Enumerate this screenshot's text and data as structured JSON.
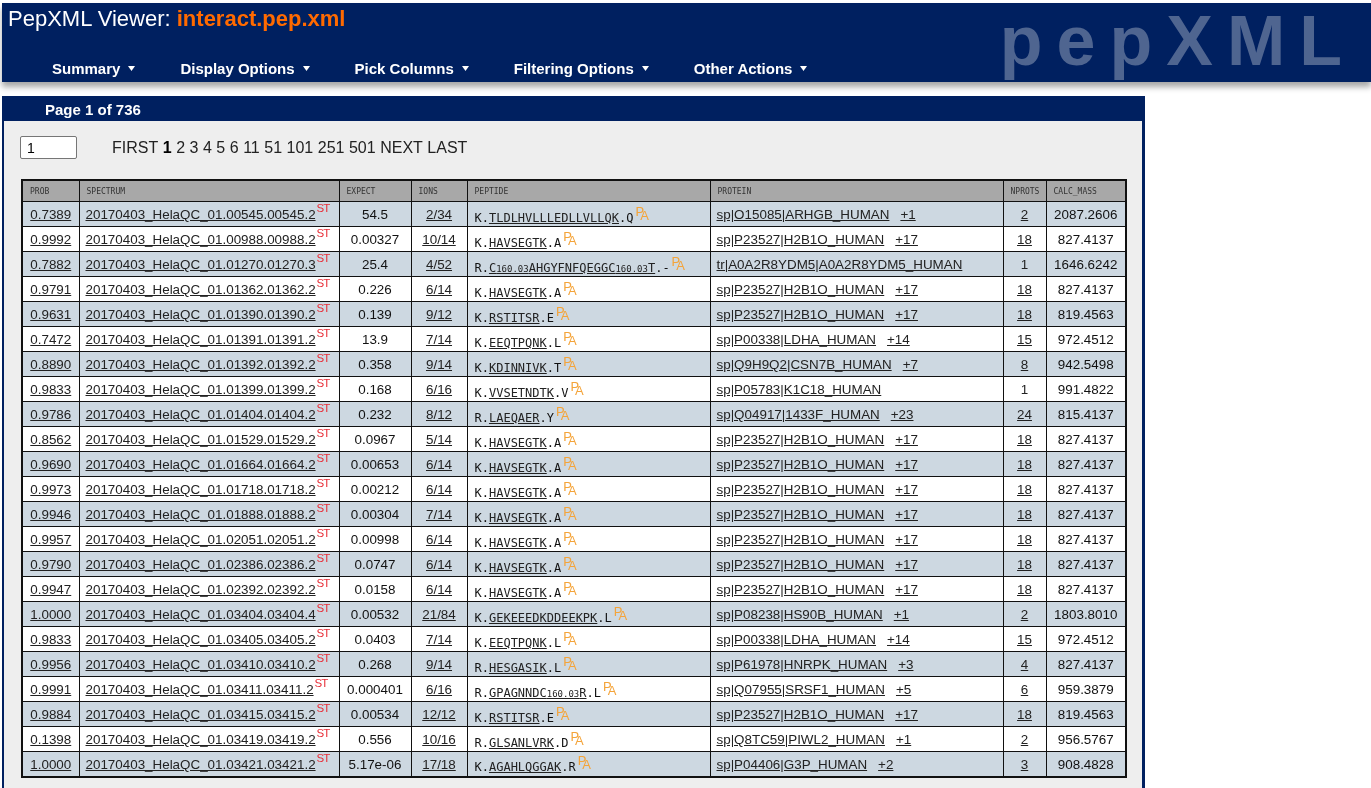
{
  "header": {
    "title": "PepXML Viewer: **interact.pep.xml**",
    "logo": "pepXML"
  },
  "menu": [
    {
      "label": "Summary"
    },
    {
      "label": "Display Options"
    },
    {
      "label": "Pick Columns"
    },
    {
      "label": "Filtering Options"
    },
    {
      "label": "Other Actions"
    }
  ],
  "page_bar": {
    "title": "Page 1 of 736"
  },
  "pager": {
    "value": "1",
    "links": [
      {
        "label": "FIRST",
        "selected": false
      },
      {
        "label": "1",
        "selected": true
      },
      {
        "label": "2",
        "selected": false
      },
      {
        "label": "3",
        "selected": false
      },
      {
        "label": "4",
        "selected": false
      },
      {
        "label": "5",
        "selected": false
      },
      {
        "label": "6",
        "selected": false
      },
      {
        "label": "11",
        "selected": false
      },
      {
        "label": "51",
        "selected": false
      },
      {
        "label": "101",
        "selected": false
      },
      {
        "label": "251",
        "selected": false
      },
      {
        "label": "501",
        "selected": false
      },
      {
        "label": "NEXT",
        "selected": false
      },
      {
        "label": "LAST",
        "selected": false
      }
    ]
  },
  "table": {
    "columns": [
      "PROB",
      "SPECTRUM",
      "EXPECT",
      "IONS",
      "PEPTIDE",
      "PROTEIN",
      "NPROTS",
      "CALC_MASS"
    ],
    "rows": [
      {
        "prob": "0.7389",
        "spectrum": "20170403_HelaQC_01.00545.00545.2",
        "spectrum_tag": "ST",
        "expect": "54.5",
        "ions": "2/34",
        "peptide": {
          "prev": "K.",
          "sequence": "TLDLHVLLLEDLLVLLQK",
          "next": ".Q",
          "tag": "PA"
        },
        "protein": "sp|O15085|ARHGB_HUMAN",
        "more": "+1",
        "nprots": "2",
        "nprots_linked": true,
        "calc_mass": "2087.2606"
      },
      {
        "prob": "0.9992",
        "spectrum": "20170403_HelaQC_01.00988.00988.2",
        "spectrum_tag": "ST",
        "expect": "0.00327",
        "ions": "10/14",
        "peptide": {
          "prev": "K.",
          "sequence": "HAVSEGTK",
          "next": ".A",
          "tag": "PA"
        },
        "protein": "sp|P23527|H2B1O_HUMAN",
        "more": "+17",
        "nprots": "18",
        "nprots_linked": true,
        "calc_mass": "827.4137"
      },
      {
        "prob": "0.7882",
        "spectrum": "20170403_HelaQC_01.01270.01270.3",
        "spectrum_tag": "ST",
        "expect": "25.4",
        "ions": "4/52",
        "peptide": {
          "prev": "R.",
          "sequence": "C$_{160.03}$AHGYFNFQEGGC$_{160.03}$T",
          "next": ".-",
          "tag": "PA"
        },
        "protein": "tr|A0A2R8YDM5|A0A2R8YDM5_HUMAN",
        "nprots": "1",
        "nprots_linked": false,
        "calc_mass": "1646.6242"
      },
      {
        "prob": "0.9791",
        "spectrum": "20170403_HelaQC_01.01362.01362.2",
        "spectrum_tag": "ST",
        "expect": "0.226",
        "ions": "6/14",
        "peptide": {
          "prev": "K.",
          "sequence": "HAVSEGTK",
          "next": ".A",
          "tag": "PA"
        },
        "protein": "sp|P23527|H2B1O_HUMAN",
        "more": "+17",
        "nprots": "18",
        "nprots_linked": true,
        "calc_mass": "827.4137"
      },
      {
        "prob": "0.9631",
        "spectrum": "20170403_HelaQC_01.01390.01390.2",
        "spectrum_tag": "ST",
        "expect": "0.139",
        "ions": "9/12",
        "peptide": {
          "prev": "K.",
          "sequence": "RSTITSR",
          "next": ".E",
          "tag": "PA"
        },
        "protein": "sp|P23527|H2B1O_HUMAN",
        "more": "+17",
        "nprots": "18",
        "nprots_linked": true,
        "calc_mass": "819.4563"
      },
      {
        "prob": "0.7472",
        "spectrum": "20170403_HelaQC_01.01391.01391.2",
        "spectrum_tag": "ST",
        "expect": "13.9",
        "ions": "7/14",
        "peptide": {
          "prev": "K.",
          "sequence": "EEQTPQNK",
          "next": ".L",
          "tag": "PA"
        },
        "protein": "sp|P00338|LDHA_HUMAN",
        "more": "+14",
        "nprots": "15",
        "nprots_linked": true,
        "calc_mass": "972.4512"
      },
      {
        "prob": "0.8890",
        "spectrum": "20170403_HelaQC_01.01392.01392.2",
        "spectrum_tag": "ST",
        "expect": "0.358",
        "ions": "9/14",
        "peptide": {
          "prev": "K.",
          "sequence": "KDINNIVK",
          "next": ".T",
          "tag": "PA"
        },
        "protein": "sp|Q9H9Q2|CSN7B_HUMAN",
        "more": "+7",
        "nprots": "8",
        "nprots_linked": true,
        "calc_mass": "942.5498"
      },
      {
        "prob": "0.9833",
        "spectrum": "20170403_HelaQC_01.01399.01399.2",
        "spectrum_tag": "ST",
        "expect": "0.168",
        "ions": "6/16",
        "peptide": {
          "prev": "K.",
          "sequence": "VVSETNDTK",
          "next": ".V",
          "tag": "PA"
        },
        "protein": "sp|P05783|K1C18_HUMAN",
        "nprots": "1",
        "nprots_linked": false,
        "calc_mass": "991.4822"
      },
      {
        "prob": "0.9786",
        "spectrum": "20170403_HelaQC_01.01404.01404.2",
        "spectrum_tag": "ST",
        "expect": "0.232",
        "ions": "8/12",
        "peptide": {
          "prev": "R.",
          "sequence": "LAEQAER",
          "next": ".Y",
          "tag": "PA"
        },
        "protein": "sp|Q04917|1433F_HUMAN",
        "more": "+23",
        "nprots": "24",
        "nprots_linked": true,
        "calc_mass": "815.4137"
      },
      {
        "prob": "0.8562",
        "spectrum": "20170403_HelaQC_01.01529.01529.2",
        "spectrum_tag": "ST",
        "expect": "0.0967",
        "ions": "5/14",
        "peptide": {
          "prev": "K.",
          "sequence": "HAVSEGTK",
          "next": ".A",
          "tag": "PA"
        },
        "protein": "sp|P23527|H2B1O_HUMAN",
        "more": "+17",
        "nprots": "18",
        "nprots_linked": true,
        "calc_mass": "827.4137"
      },
      {
        "prob": "0.9690",
        "spectrum": "20170403_HelaQC_01.01664.01664.2",
        "spectrum_tag": "ST",
        "expect": "0.00653",
        "ions": "6/14",
        "peptide": {
          "prev": "K.",
          "sequence": "HAVSEGTK",
          "next": ".A",
          "tag": "PA"
        },
        "protein": "sp|P23527|H2B1O_HUMAN",
        "more": "+17",
        "nprots": "18",
        "nprots_linked": true,
        "calc_mass": "827.4137"
      },
      {
        "prob": "0.9973",
        "spectrum": "20170403_HelaQC_01.01718.01718.2",
        "spectrum_tag": "ST",
        "expect": "0.00212",
        "ions": "6/14",
        "peptide": {
          "prev": "K.",
          "sequence": "HAVSEGTK",
          "next": ".A",
          "tag": "PA"
        },
        "protein": "sp|P23527|H2B1O_HUMAN",
        "more": "+17",
        "nprots": "18",
        "nprots_linked": true,
        "calc_mass": "827.4137"
      },
      {
        "prob": "0.9946",
        "spectrum": "20170403_HelaQC_01.01888.01888.2",
        "spectrum_tag": "ST",
        "expect": "0.00304",
        "ions": "7/14",
        "peptide": {
          "prev": "K.",
          "sequence": "HAVSEGTK",
          "next": ".A",
          "tag": "PA"
        },
        "protein": "sp|P23527|H2B1O_HUMAN",
        "more": "+17",
        "nprots": "18",
        "nprots_linked": true,
        "calc_mass": "827.4137"
      },
      {
        "prob": "0.9957",
        "spectrum": "20170403_HelaQC_01.02051.02051.2",
        "spectrum_tag": "ST",
        "expect": "0.00998",
        "ions": "6/14",
        "peptide": {
          "prev": "K.",
          "sequence": "HAVSEGTK",
          "next": ".A",
          "tag": "PA"
        },
        "protein": "sp|P23527|H2B1O_HUMAN",
        "more": "+17",
        "nprots": "18",
        "nprots_linked": true,
        "calc_mass": "827.4137"
      },
      {
        "prob": "0.9790",
        "spectrum": "20170403_HelaQC_01.02386.02386.2",
        "spectrum_tag": "ST",
        "expect": "0.0747",
        "ions": "6/14",
        "peptide": {
          "prev": "K.",
          "sequence": "HAVSEGTK",
          "next": ".A",
          "tag": "PA"
        },
        "protein": "sp|P23527|H2B1O_HUMAN",
        "more": "+17",
        "nprots": "18",
        "nprots_linked": true,
        "calc_mass": "827.4137"
      },
      {
        "prob": "0.9947",
        "spectrum": "20170403_HelaQC_01.02392.02392.2",
        "spectrum_tag": "ST",
        "expect": "0.0158",
        "ions": "6/14",
        "peptide": {
          "prev": "K.",
          "sequence": "HAVSEGTK",
          "next": ".A",
          "tag": "PA"
        },
        "protein": "sp|P23527|H2B1O_HUMAN",
        "more": "+17",
        "nprots": "18",
        "nprots_linked": true,
        "calc_mass": "827.4137"
      },
      {
        "prob": "1.0000",
        "spectrum": "20170403_HelaQC_01.03404.03404.4",
        "spectrum_tag": "ST",
        "expect": "0.00532",
        "ions": "21/84",
        "peptide": {
          "prev": "K.",
          "sequence": "GEKEEEDKDDEEKPK",
          "next": ".L",
          "tag": "PA"
        },
        "protein": "sp|P08238|HS90B_HUMAN",
        "more": "+1",
        "nprots": "2",
        "nprots_linked": true,
        "calc_mass": "1803.8010"
      },
      {
        "prob": "0.9833",
        "spectrum": "20170403_HelaQC_01.03405.03405.2",
        "spectrum_tag": "ST",
        "expect": "0.0403",
        "ions": "7/14",
        "peptide": {
          "prev": "K.",
          "sequence": "EEQTPQNK",
          "next": ".L",
          "tag": "PA"
        },
        "protein": "sp|P00338|LDHA_HUMAN",
        "more": "+14",
        "nprots": "15",
        "nprots_linked": true,
        "calc_mass": "972.4512"
      },
      {
        "prob": "0.9956",
        "spectrum": "20170403_HelaQC_01.03410.03410.2",
        "spectrum_tag": "ST",
        "expect": "0.268",
        "ions": "9/14",
        "peptide": {
          "prev": "R.",
          "sequence": "HESGASIK",
          "next": ".L",
          "tag": "PA"
        },
        "protein": "sp|P61978|HNRPK_HUMAN",
        "more": "+3",
        "nprots": "4",
        "nprots_linked": true,
        "calc_mass": "827.4137"
      },
      {
        "prob": "0.9991",
        "spectrum": "20170403_HelaQC_01.03411.03411.2",
        "spectrum_tag": "ST",
        "expect": "0.000401",
        "ions": "6/16",
        "peptide": {
          "prev": "R.",
          "sequence": "GPAGNNDC$_{160.03}$R",
          "next": ".L",
          "tag": "PA"
        },
        "protein": "sp|Q07955|SRSF1_HUMAN",
        "more": "+5",
        "nprots": "6",
        "nprots_linked": true,
        "calc_mass": "959.3879"
      },
      {
        "prob": "0.9884",
        "spectrum": "20170403_HelaQC_01.03415.03415.2",
        "spectrum_tag": "ST",
        "expect": "0.00534",
        "ions": "12/12",
        "peptide": {
          "prev": "K.",
          "sequence": "RSTITSR",
          "next": ".E",
          "tag": "PA"
        },
        "protein": "sp|P23527|H2B1O_HUMAN",
        "more": "+17",
        "nprots": "18",
        "nprots_linked": true,
        "calc_mass": "819.4563"
      },
      {
        "prob": "0.1398",
        "spectrum": "20170403_HelaQC_01.03419.03419.2",
        "spectrum_tag": "ST",
        "expect": "0.556",
        "ions": "10/16",
        "peptide": {
          "prev": "R.",
          "sequence": "GLSANLVRK",
          "next": ".D",
          "tag": "PA"
        },
        "protein": "sp|Q8TC59|PIWL2_HUMAN",
        "more": "+1",
        "nprots": "2",
        "nprots_linked": true,
        "calc_mass": "956.5767"
      },
      {
        "prob": "1.0000",
        "spectrum": "20170403_HelaQC_01.03421.03421.2",
        "spectrum_tag": "ST",
        "expect": "5.17e-06",
        "ions": "17/18",
        "peptide": {
          "prev": "K.",
          "sequence": "AGAHLQGGAK",
          "next": ".R",
          "tag": "PA"
        },
        "protein": "sp|P04406|G3P_HUMAN",
        "more": "+2",
        "nprots": "3",
        "nprots_linked": true,
        "calc_mass": "908.4828"
      }
    ]
  }
}
